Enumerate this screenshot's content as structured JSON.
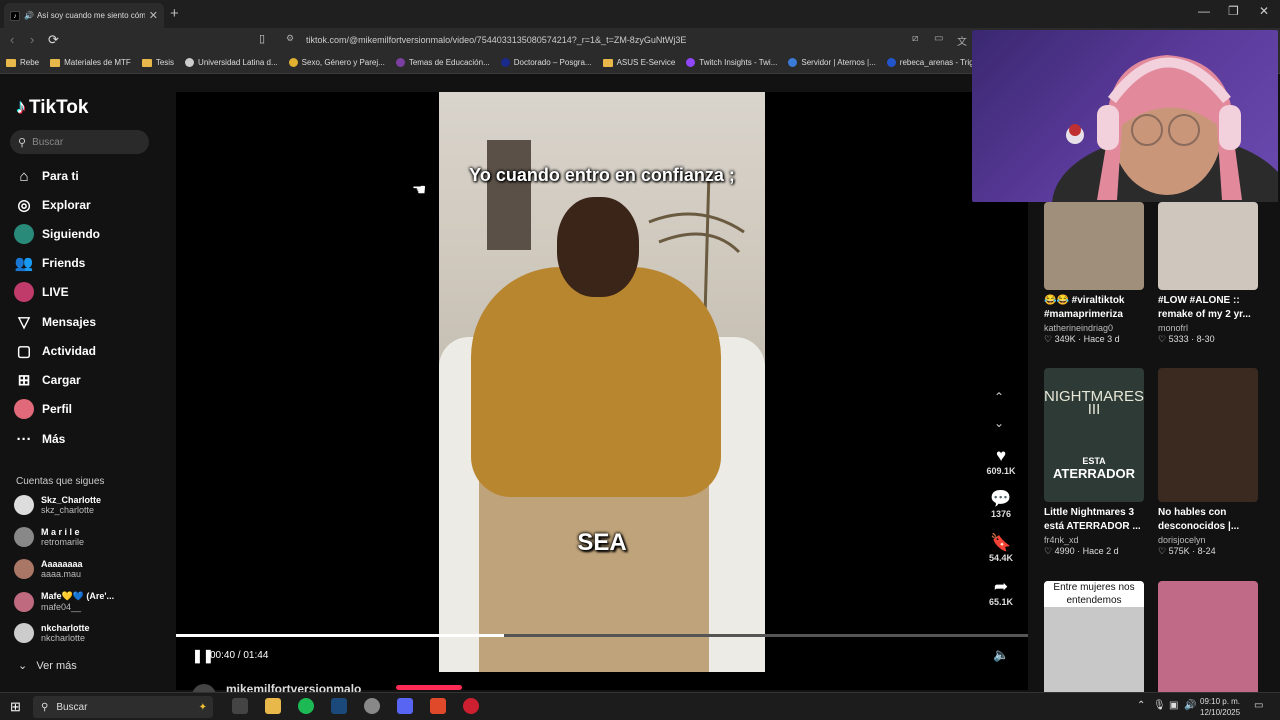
{
  "browser": {
    "tab_title": "Así soy cuando me siento cóm",
    "url": "tiktok.com/@mikemilfortversionmalo/video/7544033135080574214?_r=1&_t=ZM-8zyGuNtWj3E",
    "bookmarks": [
      {
        "label": "Rebe",
        "kind": "folder"
      },
      {
        "label": "Materiales de MTF",
        "kind": "folder"
      },
      {
        "label": "Tesis",
        "kind": "folder"
      },
      {
        "label": "Universidad Latina d...",
        "kind": "site",
        "color": "#cccccc"
      },
      {
        "label": "Sexo, Género y Parej...",
        "kind": "site",
        "color": "#e0b030"
      },
      {
        "label": "Temas de Educación...",
        "kind": "site",
        "color": "#7a3fa0"
      },
      {
        "label": "Doctorado – Posgra...",
        "kind": "site",
        "color": "#1a2a8a"
      },
      {
        "label": "ASUS E-Service",
        "kind": "folder"
      },
      {
        "label": "Twitch Insights - Twi...",
        "kind": "site",
        "color": "#9146ff"
      },
      {
        "label": "Servidor | Aternos |...",
        "kind": "site",
        "color": "#3a7ad8"
      },
      {
        "label": "rebeca_arenas - Trig...",
        "kind": "site",
        "color": "#2255cc"
      }
    ]
  },
  "tiktok": {
    "brand": "TikTok",
    "search_placeholder": "Buscar",
    "nav": [
      {
        "label": "Para ti",
        "icon": "home-icon"
      },
      {
        "label": "Explorar",
        "icon": "compass-icon"
      },
      {
        "label": "Siguiendo",
        "icon": "following-avatar"
      },
      {
        "label": "Friends",
        "icon": "friends-icon"
      },
      {
        "label": "LIVE",
        "icon": "live-avatar"
      },
      {
        "label": "Mensajes",
        "icon": "send-icon"
      },
      {
        "label": "Actividad",
        "icon": "inbox-icon"
      },
      {
        "label": "Cargar",
        "icon": "upload-icon"
      },
      {
        "label": "Perfil",
        "icon": "profile-avatar"
      },
      {
        "label": "Más",
        "icon": "more-icon"
      }
    ],
    "following_title": "Cuentas que sigues",
    "following": [
      {
        "name": "Skz_Charlotte",
        "handle": "skz_charlotte",
        "color": "#dddddd"
      },
      {
        "name": "M a r i l e",
        "handle": "retromarile",
        "color": "#888888"
      },
      {
        "name": "Aaaaaaaa",
        "handle": "aaaa.mau",
        "color": "#aa7766"
      },
      {
        "name": "Mafe💛💙 (Are'...",
        "handle": "mafe04__",
        "color": "#c06a80"
      },
      {
        "name": "nkcharlotte",
        "handle": "nkcharlotte",
        "color": "#cccccc"
      }
    ],
    "see_more": "Ver más",
    "video": {
      "caption_top": "Yo cuando entro en confianza ;",
      "caption_mid": "SEA",
      "time": "00:40 / 01:44",
      "progress": 0.385,
      "author": "mikemilfortversionmalo",
      "likes": "609.1K",
      "comments": "1376",
      "saves": "54.4K",
      "shares": "65.1K"
    },
    "recommended": [
      {
        "title": "😂😂 #viraltiktok #mamaprimeriza",
        "user": "katherineindriag0",
        "stats": "♡ 349K · Hace 3 d",
        "bg": "#a08f7a"
      },
      {
        "title": "#LOW #ALONE :: remake of my 2 yr...",
        "user": "monofrl",
        "stats": "♡ 5333 · 8-30",
        "bg": "#cfc6bd"
      },
      {
        "title": "Little Nightmares 3 está ATERRADOR ...",
        "user": "fr4nk_xd",
        "stats": "♡ 4990 · Hace 2 d",
        "bg": "#2e3a35",
        "thumb_text_top": "NIGHTMARES III",
        "thumb_text_a": "ESTA",
        "thumb_text_b": "ATERRADOR"
      },
      {
        "title": "No hables con desconocidos |...",
        "user": "dorisjocelyn",
        "stats": "♡ 575K · 8-24",
        "bg": "#3a2a20"
      },
      {
        "title": "",
        "user": "",
        "stats": "",
        "bg": "#c8c8c8",
        "thumb_text_top": "Entre mujeres nos entendemos"
      },
      {
        "title": "",
        "user": "",
        "stats": "",
        "bg": "#c06a88"
      }
    ]
  },
  "taskbar": {
    "search": "Buscar",
    "time": "09:10 p. m.",
    "date": "12/10/2025"
  }
}
